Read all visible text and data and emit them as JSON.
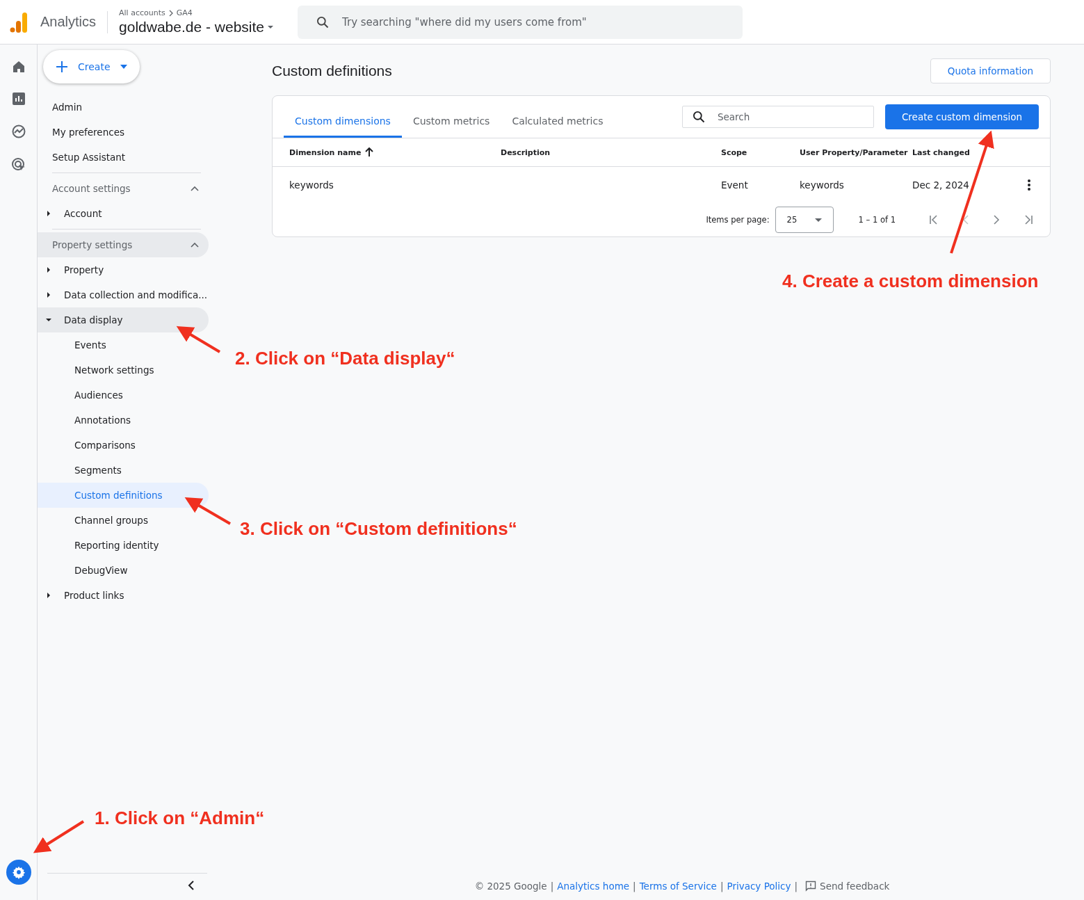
{
  "header": {
    "product": "Analytics",
    "breadcrumb": [
      "All accounts",
      "GA4"
    ],
    "property": "goldwabe.de - website",
    "search": {
      "placeholder": "Try searching \"where did my users come from\""
    }
  },
  "sidebar": {
    "create_button": "Create",
    "top_items": [
      "Admin",
      "My preferences",
      "Setup Assistant"
    ],
    "sections": [
      {
        "label": "Account settings",
        "expanded": true,
        "highlighted": false,
        "items": [
          {
            "label": "Account",
            "expanded": false,
            "selected": false,
            "highlighted": false
          }
        ]
      },
      {
        "label": "Property settings",
        "expanded": true,
        "highlighted": true,
        "items": [
          {
            "label": "Property",
            "expanded": false,
            "selected": false,
            "highlighted": false
          },
          {
            "label": "Data collection and modifica...",
            "expanded": false,
            "selected": false,
            "highlighted": false
          },
          {
            "label": "Data display",
            "expanded": true,
            "selected": false,
            "highlighted": true,
            "children": [
              {
                "label": "Events",
                "selected": false
              },
              {
                "label": "Network settings",
                "selected": false
              },
              {
                "label": "Audiences",
                "selected": false
              },
              {
                "label": "Annotations",
                "selected": false
              },
              {
                "label": "Comparisons",
                "selected": false
              },
              {
                "label": "Segments",
                "selected": false
              },
              {
                "label": "Custom definitions",
                "selected": true
              },
              {
                "label": "Channel groups",
                "selected": false
              },
              {
                "label": "Reporting identity",
                "selected": false
              },
              {
                "label": "DebugView",
                "selected": false
              }
            ]
          },
          {
            "label": "Product links",
            "expanded": false,
            "selected": false,
            "highlighted": false
          }
        ]
      }
    ]
  },
  "main": {
    "title": "Custom definitions",
    "quota_button": "Quota information",
    "tabs": [
      {
        "label": "Custom dimensions",
        "selected": true
      },
      {
        "label": "Custom metrics",
        "selected": false
      },
      {
        "label": "Calculated metrics",
        "selected": false
      }
    ],
    "search": {
      "placeholder": "Search"
    },
    "create_button": "Create custom dimension",
    "table": {
      "columns": [
        "Dimension name",
        "Description",
        "Scope",
        "User Property/Parameter",
        "Last changed"
      ],
      "rows": [
        [
          "keywords",
          "",
          "Event",
          "keywords",
          "Dec 2, 2024"
        ]
      ]
    },
    "pagination": {
      "label": "Items per page:",
      "page_size": "25",
      "range": "1 – 1 of 1"
    }
  },
  "footer": [
    {
      "kind": "text",
      "text": "© 2025 Google"
    },
    {
      "kind": "separator",
      "text": "|"
    },
    {
      "kind": "link",
      "text": "Analytics home"
    },
    {
      "kind": "separator",
      "text": "|"
    },
    {
      "kind": "link",
      "text": "Terms of Service"
    },
    {
      "kind": "separator",
      "text": "|"
    },
    {
      "kind": "link",
      "text": "Privacy Policy"
    },
    {
      "kind": "separator",
      "text": "|"
    },
    {
      "kind": "feedback",
      "text": "Send feedback"
    }
  ],
  "annotations": [
    "1. Click on “Admin“",
    "2. Click on “Data display“",
    "3. Click on “Custom definitions“",
    "4. Create a custom dimension"
  ]
}
